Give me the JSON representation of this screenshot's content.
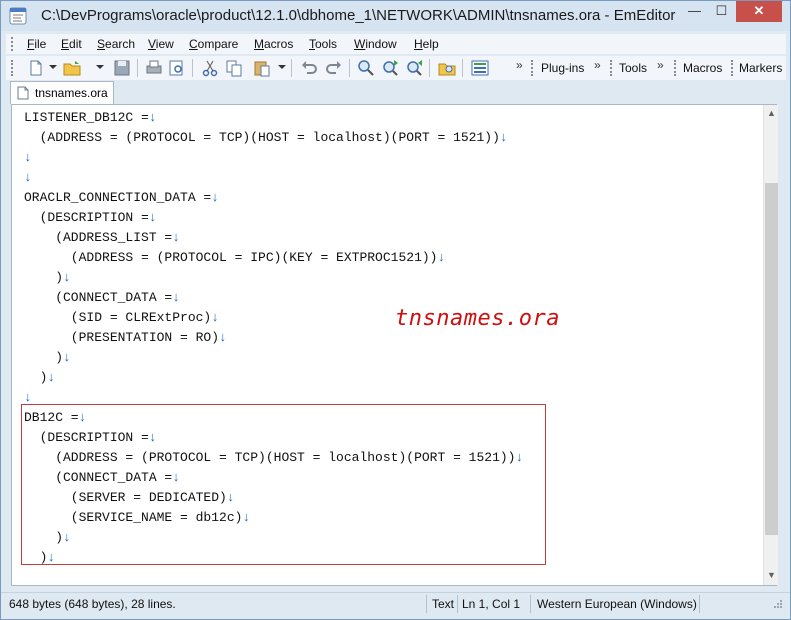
{
  "window": {
    "title": "C:\\DevPrograms\\oracle\\product\\12.1.0\\dbhome_1\\NETWORK\\ADMIN\\tnsnames.ora - EmEditor",
    "minimize_glyph": "—",
    "maximize_glyph": "☐",
    "close_glyph": "✕"
  },
  "menu": {
    "items": [
      {
        "label": "File",
        "mnemonic": "F"
      },
      {
        "label": "Edit",
        "mnemonic": "E"
      },
      {
        "label": "Search",
        "mnemonic": "S"
      },
      {
        "label": "View",
        "mnemonic": "V"
      },
      {
        "label": "Compare",
        "mnemonic": "C"
      },
      {
        "label": "Macros",
        "mnemonic": "M"
      },
      {
        "label": "Tools",
        "mnemonic": "T"
      },
      {
        "label": "Window",
        "mnemonic": "W"
      },
      {
        "label": "Help",
        "mnemonic": "H"
      }
    ]
  },
  "toolbar": {
    "more_glyph": "»",
    "plugins_label": "Plug-ins",
    "tools_label": "Tools",
    "macros_label": "Macros",
    "markers_label": "Markers"
  },
  "tab": {
    "label": "tnsnames.ora"
  },
  "editor": {
    "eol_marker": "↓",
    "lines": [
      "LISTENER_DB12C =",
      "  (ADDRESS = (PROTOCOL = TCP)(HOST = localhost)(PORT = 1521))",
      "",
      "",
      "ORACLR_CONNECTION_DATA =",
      "  (DESCRIPTION =",
      "    (ADDRESS_LIST =",
      "      (ADDRESS = (PROTOCOL = IPC)(KEY = EXTPROC1521))",
      "    )",
      "    (CONNECT_DATA =",
      "      (SID = CLRExtProc)",
      "      (PRESENTATION = RO)",
      "    )",
      "  )",
      "",
      "DB12C =",
      "  (DESCRIPTION =",
      "    (ADDRESS = (PROTOCOL = TCP)(HOST = localhost)(PORT = 1521))",
      "    (CONNECT_DATA =",
      "      (SERVER = DEDICATED)",
      "      (SERVICE_NAME = db12c)",
      "    )",
      "  )",
      ""
    ],
    "annotation": "tnsnames.ora",
    "annotation_color": "#cc1010",
    "highlight_color": "#c23b3b",
    "eol_color": "#1c6fd0"
  },
  "statusbar": {
    "size_text": "648 bytes (648 bytes), 28 lines.",
    "mode": "Text",
    "position": "Ln 1, Col 1",
    "encoding": "Western European (Windows)"
  }
}
